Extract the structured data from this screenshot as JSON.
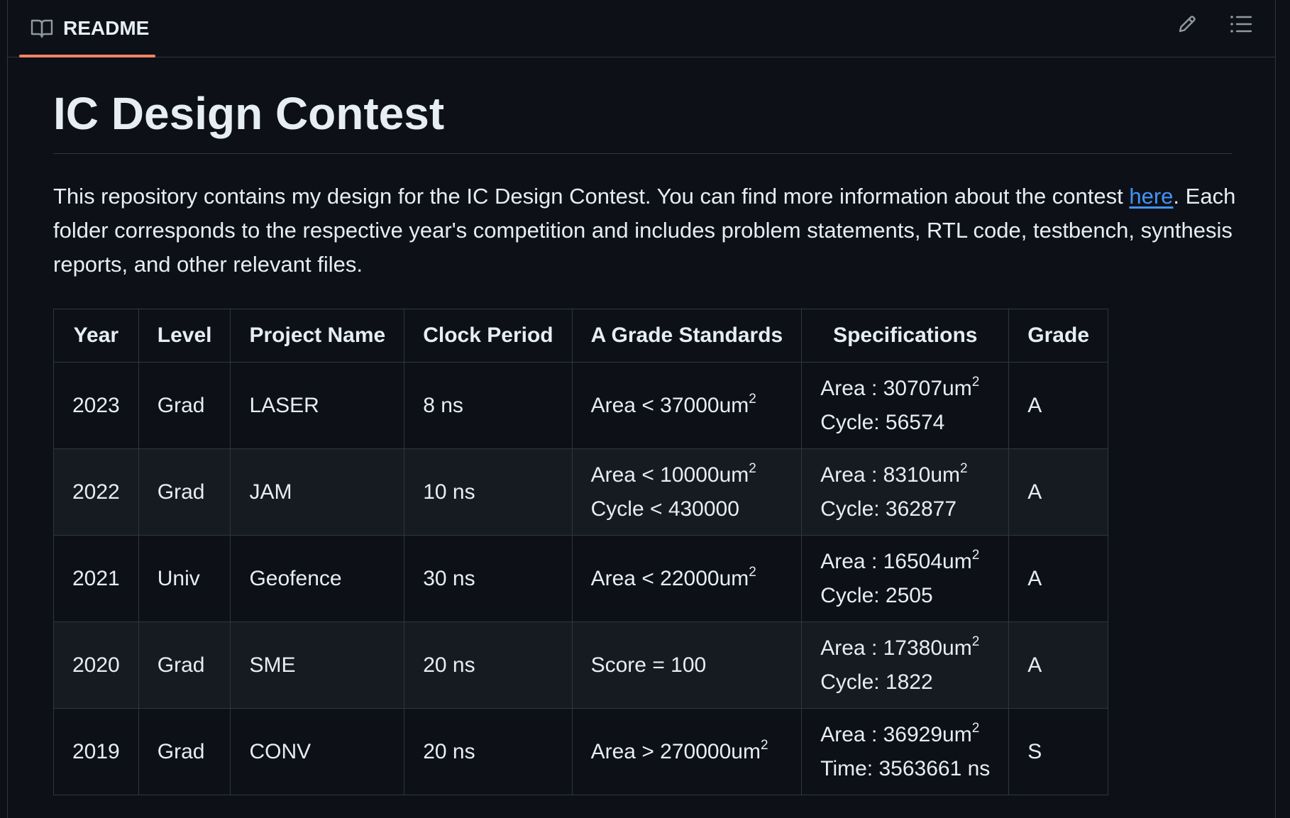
{
  "tab": {
    "label": "README",
    "icon": "book-icon"
  },
  "toolbar": {
    "edit_icon": "pencil-icon",
    "outline_icon": "list-icon"
  },
  "title": "IC Design Contest",
  "intro": {
    "before_link": "This repository contains my design for the IC Design Contest. You can find more information about the contest ",
    "link_text": "here",
    "after_link": ". Each folder corresponds to the respective year's competition and includes problem statements, RTL code, testbench, synthesis reports, and other relevant files."
  },
  "table": {
    "headers": [
      "Year",
      "Level",
      "Project Name",
      "Clock Period",
      "A Grade Standards",
      "Specifications",
      "Grade"
    ],
    "rows": [
      {
        "year": "2023",
        "level": "Grad",
        "project": "LASER",
        "clock": "8 ns",
        "standards": [
          {
            "text": "Area < 37000um",
            "sup": "2"
          }
        ],
        "specs": [
          {
            "text": "Area : 30707um",
            "sup": "2"
          },
          {
            "text": "Cycle: 56574",
            "sup": ""
          }
        ],
        "grade": "A"
      },
      {
        "year": "2022",
        "level": "Grad",
        "project": "JAM",
        "clock": "10 ns",
        "standards": [
          {
            "text": "Area < 10000um",
            "sup": "2"
          },
          {
            "text": "Cycle < 430000",
            "sup": ""
          }
        ],
        "specs": [
          {
            "text": "Area : 8310um",
            "sup": "2"
          },
          {
            "text": "Cycle: 362877",
            "sup": ""
          }
        ],
        "grade": "A"
      },
      {
        "year": "2021",
        "level": "Univ",
        "project": "Geofence",
        "clock": "30 ns",
        "standards": [
          {
            "text": "Area < 22000um",
            "sup": "2"
          }
        ],
        "specs": [
          {
            "text": "Area : 16504um",
            "sup": "2"
          },
          {
            "text": "Cycle: 2505",
            "sup": ""
          }
        ],
        "grade": "A"
      },
      {
        "year": "2020",
        "level": "Grad",
        "project": "SME",
        "clock": "20 ns",
        "standards": [
          {
            "text": "Score = 100",
            "sup": ""
          }
        ],
        "specs": [
          {
            "text": "Area : 17380um",
            "sup": "2"
          },
          {
            "text": "Cycle: 1822",
            "sup": ""
          }
        ],
        "grade": "A"
      },
      {
        "year": "2019",
        "level": "Grad",
        "project": "CONV",
        "clock": "20 ns",
        "standards": [
          {
            "text": "Area > 270000um",
            "sup": "2"
          }
        ],
        "specs": [
          {
            "text": "Area : 36929um",
            "sup": "2"
          },
          {
            "text": "Time: 3563661 ns",
            "sup": ""
          }
        ],
        "grade": "S"
      }
    ]
  }
}
